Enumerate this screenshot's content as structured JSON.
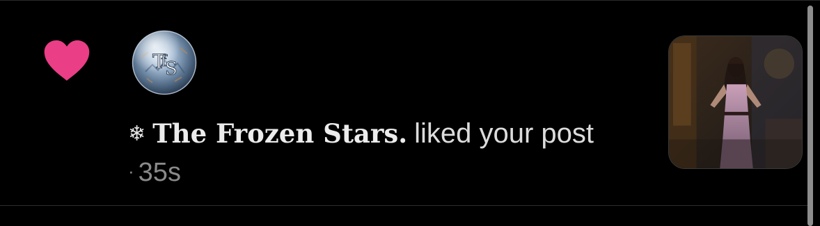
{
  "notification": {
    "type_icon": "heart-icon",
    "type_color": "#ea3e86",
    "avatar": {
      "icon": "frozen-stars-logo",
      "monogram": "TFS"
    },
    "prefix_icon": "snowflake-icon",
    "prefix_glyph": "❄",
    "username": "The Frozen Stars.",
    "action_text": "liked your post",
    "separator": "·",
    "time": "35s",
    "thumbnail": {
      "icon": "post-thumbnail-image"
    }
  }
}
